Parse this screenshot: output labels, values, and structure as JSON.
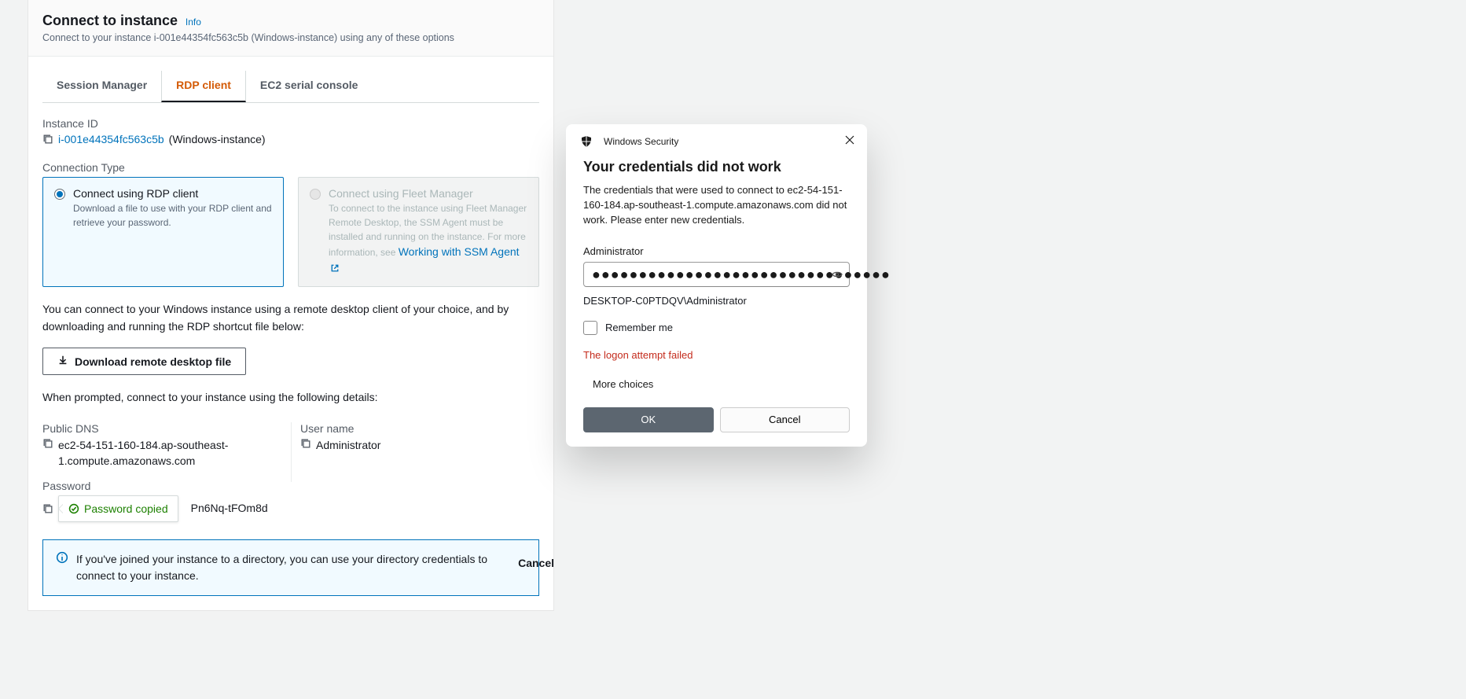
{
  "aws": {
    "title": "Connect to instance",
    "info": "Info",
    "subtitle": "Connect to your instance i-001e44354fc563c5b (Windows-instance) using any of these options",
    "tabs": [
      "Session Manager",
      "RDP client",
      "EC2 serial console"
    ],
    "instance_id_label": "Instance ID",
    "instance_id": "i-001e44354fc563c5b",
    "instance_name": "(Windows-instance)",
    "connection_type_label": "Connection Type",
    "card_rdp_title": "Connect using RDP client",
    "card_rdp_desc": "Download a file to use with your RDP client and retrieve your password.",
    "card_fleet_title": "Connect using Fleet Manager",
    "card_fleet_desc": "To connect to the instance using Fleet Manager Remote Desktop, the SSM Agent must be installed and running on the instance. For more information, see ",
    "card_fleet_link": "Working with SSM Agent",
    "connect_paragraph": "You can connect to your Windows instance using a remote desktop client of your choice, and by downloading and running the RDP shortcut file below:",
    "download_button": "Download remote desktop file",
    "prompt_paragraph": "When prompted, connect to your instance using the following details:",
    "public_dns_label": "Public DNS",
    "public_dns": "ec2-54-151-160-184.ap-southeast-1.compute.amazonaws.com",
    "username_label": "User name",
    "username": "Administrator",
    "password_label": "Password",
    "password_tail": "Pn6Nq-tFOm8d",
    "tooltip": "Password copied",
    "info_box": "If you've joined your instance to a directory, you can use your directory credentials to connect to your instance.",
    "cancel": "Cancel"
  },
  "win": {
    "top_label": "Windows Security",
    "title": "Your credentials did not work",
    "message": "The credentials that were used to connect to ec2-54-151-160-184.ap-southeast-1.compute.amazonaws.com did not work. Please enter new credentials.",
    "user": "Administrator",
    "password_dots": "●●●●●●●●●●●●●●●●●●●●●●●●●●●●●●●●",
    "account": "DESKTOP-C0PTDQV\\Administrator",
    "remember": "Remember me",
    "error": "The logon attempt failed",
    "more": "More choices",
    "ok": "OK",
    "cancel": "Cancel"
  }
}
